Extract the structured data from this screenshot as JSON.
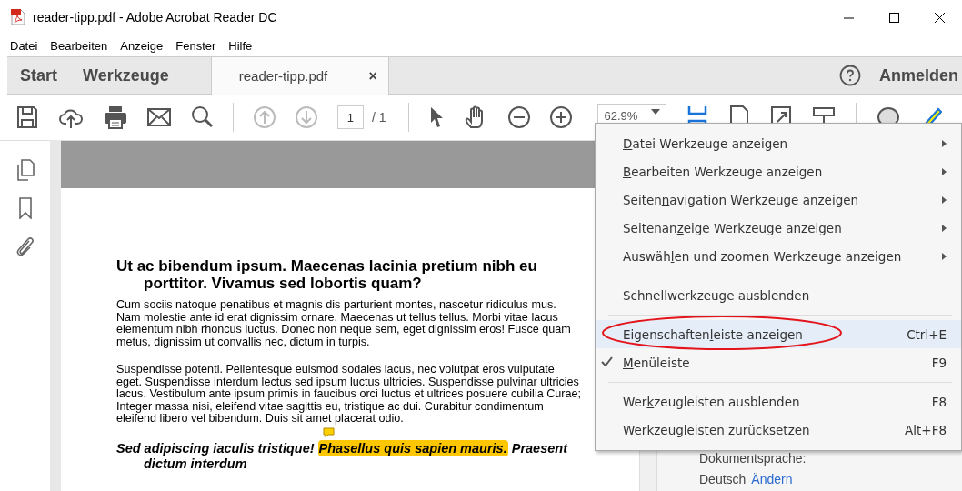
{
  "window": {
    "title": "reader-tipp.pdf - Adobe Acrobat Reader DC"
  },
  "menubar": [
    "Datei",
    "Bearbeiten",
    "Anzeige",
    "Fenster",
    "Hilfe"
  ],
  "tabs": [
    {
      "label": "Start",
      "kind": "nav",
      "selected": false
    },
    {
      "label": "Werkzeuge",
      "kind": "nav",
      "selected": false
    },
    {
      "label": "reader-tipp.pdf",
      "kind": "document",
      "selected": true,
      "close": "×"
    }
  ],
  "account": {
    "label": "Anmelden"
  },
  "toolbar": {
    "page_number": "1",
    "page_total": "/ 1",
    "zoom": "62.9%"
  },
  "document": {
    "heading": "Ut ac bibendum ipsum. Maecenas lacinia pretium nibh eu porttitor. Vivamus sed lobortis quam?",
    "paragraphs": [
      " Cum sociis natoque penatibus et magnis dis parturient montes, nascetur ridiculus mus. Nam molestie ante id erat dignissim ornare. Maecenas ut tellus tellus. Morbi vitae lacus elementum nibh rhoncus luctus. Donec non neque sem, eget dignissim eros! Fusce quam metus, dignissim ut convallis nec, dictum in turpis.",
      "Suspendisse potenti. Pellentesque euismod sodales lacus, nec volutpat eros vulputate eget. Suspendisse interdum lectus sed ipsum luctus ultricies. Suspendisse pulvinar ultricies lacus. Vestibulum ante ipsum primis in faucibus orci luctus et ultrices posuere cubilia Curae; Integer massa nisi, eleifend vitae sagittis eu, tristique ac dui. Curabitur condimentum eleifend libero vel bibendum. Duis sit amet placerat odio."
    ],
    "subheading": [
      {
        "text": "Sed adipiscing iaculis tristique! ",
        "highlighted": false
      },
      {
        "text": "Phasellus quis sapien mauris.",
        "highlighted": true
      },
      {
        "text": " Praesent dictum interdum",
        "highlighted": false
      }
    ]
  },
  "properties_panel": {
    "language_label": "Dokumentsprache:",
    "language": "Deutsch",
    "change_link": "Ändern"
  },
  "context_menu": {
    "items": [
      {
        "kind": "item",
        "label_parts": {
          "key": "D",
          "post": "atei Werkzeuge anzeigen"
        },
        "submenu": true,
        "selected": false,
        "checked": false
      },
      {
        "kind": "item",
        "label_parts": {
          "key": "B",
          "post": "earbeiten Werkzeuge anzeigen"
        },
        "submenu": true,
        "selected": false,
        "checked": false
      },
      {
        "kind": "item",
        "label_parts": {
          "pre": "Seiten",
          "key": "n",
          "post": "avigation Werkzeuge anzeigen"
        },
        "submenu": true,
        "selected": false,
        "checked": false
      },
      {
        "kind": "item",
        "label_parts": {
          "pre": "Seitenan",
          "key": "z",
          "post": "eige Werkzeuge anzeigen"
        },
        "submenu": true,
        "selected": false,
        "checked": false
      },
      {
        "kind": "item",
        "label_parts": {
          "pre": "Auswäh",
          "key": "l",
          "post": "en und zoomen Werkzeuge anzeigen"
        },
        "submenu": true,
        "selected": false,
        "checked": false
      },
      {
        "kind": "separator"
      },
      {
        "kind": "item",
        "label_parts": {
          "pre": "Schnellwerkzeuge ausblenden"
        },
        "submenu": false,
        "selected": false,
        "checked": false
      },
      {
        "kind": "separator"
      },
      {
        "kind": "item",
        "label_parts": {
          "pre": "Eigenschaften",
          "key": "l",
          "post": "eiste anzeigen"
        },
        "shortcut": "Ctrl+E",
        "submenu": false,
        "selected": true,
        "checked": false,
        "circled": true
      },
      {
        "kind": "item",
        "label_parts": {
          "key": "M",
          "post": "enüleiste"
        },
        "shortcut": "F9",
        "submenu": false,
        "selected": false,
        "checked": true
      },
      {
        "kind": "separator"
      },
      {
        "kind": "item",
        "label_parts": {
          "pre": "Wer",
          "key": "k",
          "post": "zeugleisten ausblenden"
        },
        "shortcut": "F8",
        "submenu": false,
        "selected": false,
        "checked": false
      },
      {
        "kind": "item",
        "label_parts": {
          "key": "W",
          "post": "erkzeugleisten zurücksetzen"
        },
        "shortcut": "Alt+F8",
        "submenu": false,
        "selected": false,
        "checked": false
      }
    ]
  }
}
